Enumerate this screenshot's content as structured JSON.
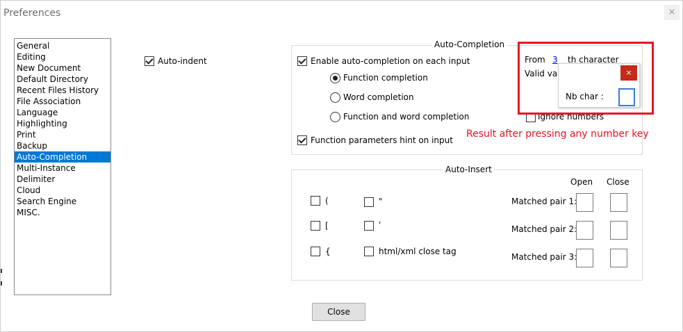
{
  "window": {
    "title": "Preferences",
    "close_symbol": "×"
  },
  "categories": [
    "General",
    "Editing",
    "New Document",
    "Default Directory",
    "Recent Files History",
    "File Association",
    "Language",
    "Highlighting",
    "Print",
    "Backup",
    "Auto-Completion",
    "Multi-Instance",
    "Delimiter",
    "Cloud",
    "Search Engine",
    "MISC."
  ],
  "selected_category": "Auto-Completion",
  "auto_indent": {
    "label": "Auto-indent",
    "checked": true
  },
  "auto_completion": {
    "title": "Auto-Completion",
    "enable_label": "Enable auto-completion on each input",
    "enable_checked": true,
    "radio_function": "Function completion",
    "radio_word": "Word completion",
    "radio_both": "Function and word completion",
    "selected_radio": "Function completion",
    "params_hint_label": "Function parameters hint on input",
    "params_hint_checked": true,
    "from_label": "From",
    "from_value": "3",
    "th_character": "th character",
    "valid_value_partial": "Valid val",
    "ignore_numbers_label": "Ignore numbers",
    "ignore_numbers_checked": false
  },
  "popup": {
    "close_symbol": "×",
    "label": "Nb char :",
    "value": ""
  },
  "annotation": {
    "text": "Result after pressing any number key",
    "color": "#e81123"
  },
  "auto_insert": {
    "title": "Auto-Insert",
    "open_header": "Open",
    "close_header": "Close",
    "brackets": [
      "(",
      "[",
      "{"
    ],
    "quotes": [
      "\"",
      "'"
    ],
    "html_close_tag_label": "html/xml close tag",
    "matched_pairs": [
      "Matched pair 1:",
      "Matched pair 2:",
      "Matched pair 3:"
    ]
  },
  "close_button": {
    "label": "Close"
  }
}
